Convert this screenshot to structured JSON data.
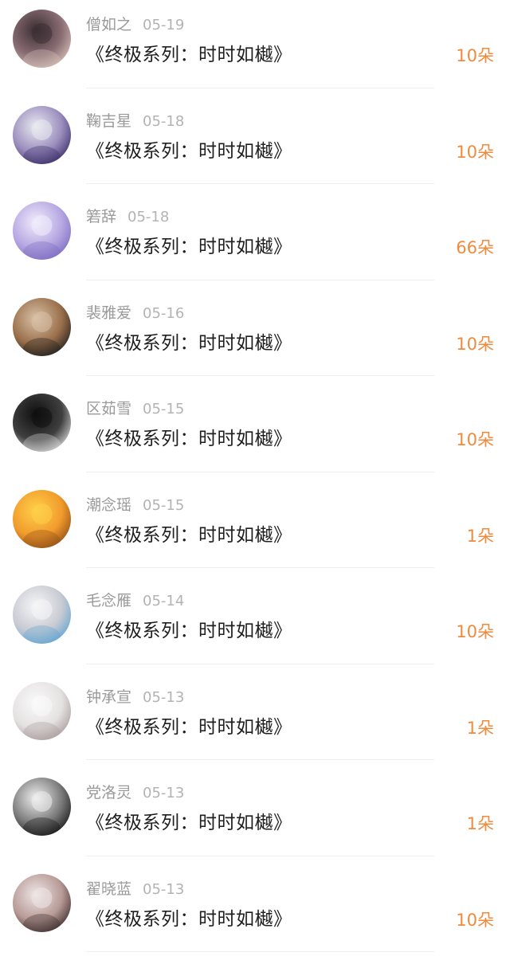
{
  "rows": [
    {
      "name": "僧如之",
      "date": "05-19",
      "title": "《终极系列：时时如樾》",
      "amount": "10朵",
      "avatar": {
        "icon": "avatar-dark-figure",
        "c1": "#3b2e33",
        "c2": "#8a6e74",
        "c3": "#d7c2b9"
      }
    },
    {
      "name": "鞠吉星",
      "date": "05-18",
      "title": "《终极系列：时时如樾》",
      "amount": "10朵",
      "avatar": {
        "icon": "avatar-love-text",
        "c1": "#e9eaf0",
        "c2": "#9a8dbd",
        "c3": "#3a2c66"
      }
    },
    {
      "name": "箬辞",
      "date": "05-18",
      "title": "《终极系列：时时如樾》",
      "amount": "66朵",
      "avatar": {
        "icon": "avatar-anime-girl-lavender",
        "c1": "#f1ecfb",
        "c2": "#b6a7e2",
        "c3": "#7b6bc1"
      }
    },
    {
      "name": "裴雅爱",
      "date": "05-16",
      "title": "《终极系列：时时如樾》",
      "amount": "10朵",
      "avatar": {
        "icon": "avatar-cat-sunglasses",
        "c1": "#d8c1a7",
        "c2": "#9a6f4b",
        "c3": "#1e1e1e"
      }
    },
    {
      "name": "区茹雪",
      "date": "05-15",
      "title": "《终极系列：时时如樾》",
      "amount": "10朵",
      "avatar": {
        "icon": "avatar-dark-hair-girl",
        "c1": "#0f0f0f",
        "c2": "#3f3f3f",
        "c3": "#d9d9d9"
      }
    },
    {
      "name": "潮念瑶",
      "date": "05-15",
      "title": "《终极系列：时时如樾》",
      "amount": "1朵",
      "avatar": {
        "icon": "avatar-sunset-city",
        "c1": "#ffd04a",
        "c2": "#f19b2c",
        "c3": "#8e4d18"
      }
    },
    {
      "name": "毛念雁",
      "date": "05-14",
      "title": "《终极系列：时时如樾》",
      "amount": "10朵",
      "avatar": {
        "icon": "avatar-anime-white-hair",
        "c1": "#f6f6f8",
        "c2": "#c9cbd3",
        "c3": "#5fa3d1"
      }
    },
    {
      "name": "钟承宣",
      "date": "05-13",
      "title": "《终极系列：时时如樾》",
      "amount": "1朵",
      "avatar": {
        "icon": "avatar-white-sketch",
        "c1": "#fafafa",
        "c2": "#e4e1e1",
        "c3": "#a99a9a"
      }
    },
    {
      "name": "党洛灵",
      "date": "05-13",
      "title": "《终极系列：时时如樾》",
      "amount": "1朵",
      "avatar": {
        "icon": "avatar-bw-portrait",
        "c1": "#efefef",
        "c2": "#7a7a7a",
        "c3": "#151515"
      }
    },
    {
      "name": "翟晓蓝",
      "date": "05-13",
      "title": "《终极系列：时时如樾》",
      "amount": "10朵",
      "avatar": {
        "icon": "avatar-girl-portrait",
        "c1": "#eee6e6",
        "c2": "#b79a96",
        "c3": "#3a2a2a"
      }
    }
  ]
}
